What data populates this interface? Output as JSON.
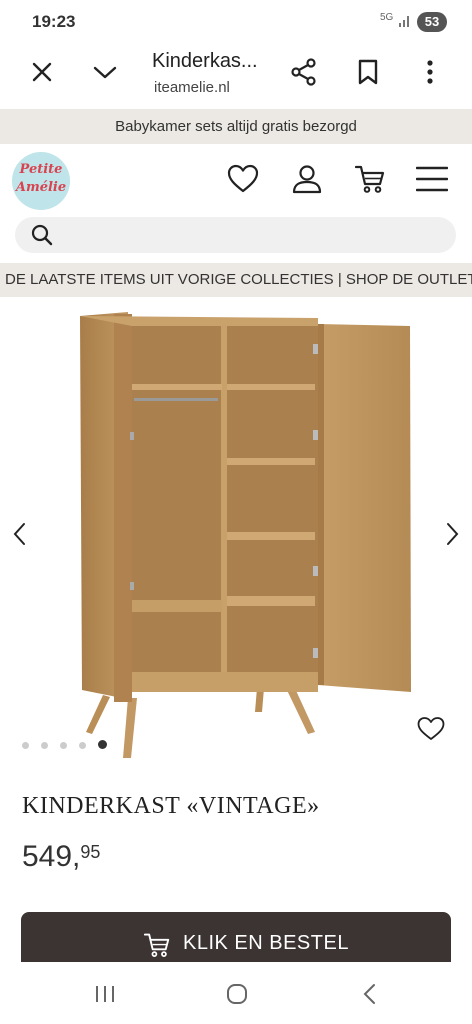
{
  "status_bar": {
    "time": "19:23",
    "network": "5G",
    "battery": "53"
  },
  "browser": {
    "title": "Kinderkas...",
    "url": "iteamelie.nl"
  },
  "promo_banner": "Babykamer sets altijd gratis bezorgd",
  "logo": {
    "line1": "Petite",
    "line2": "Amélie"
  },
  "search": {
    "placeholder": "",
    "value": ""
  },
  "outlet_banner": "DE LAATSTE ITEMS UIT VORIGE COLLECTIES | SHOP DE OUTLET",
  "carousel": {
    "total": 5,
    "active_index": 4
  },
  "product": {
    "name": "KINDERKAST «VINTAGE»",
    "price_main": "549,",
    "price_cents": "95"
  },
  "order_button": {
    "label": "KLIK EN BESTEL"
  },
  "colors": {
    "wood": "#b98e57",
    "button_bg": "#3b3432",
    "banner_bg": "#ece8e3",
    "logo_bg": "#bfe4ea",
    "logo_text": "#d8434f"
  }
}
